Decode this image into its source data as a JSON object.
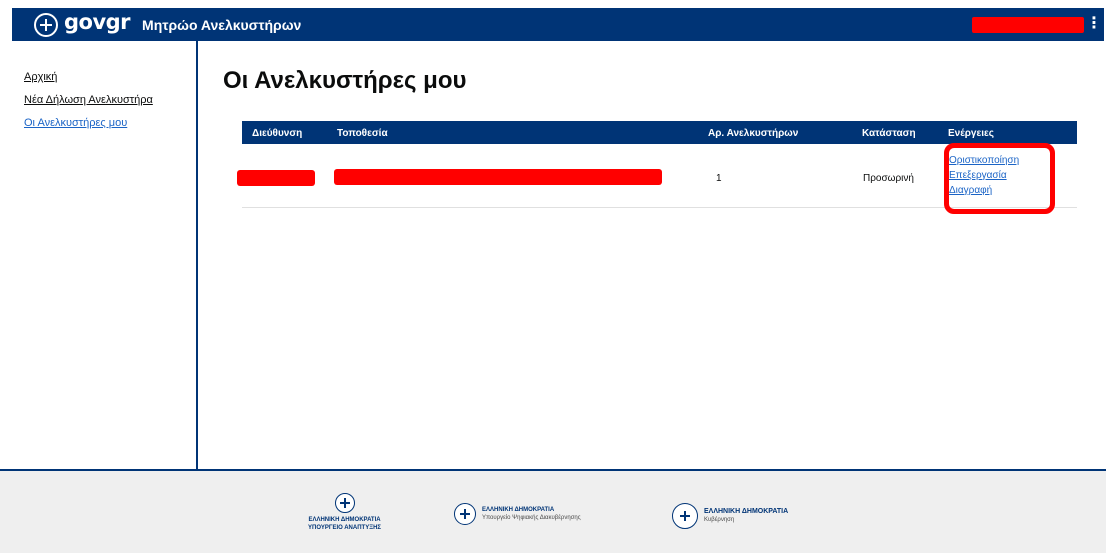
{
  "header": {
    "logo_text": "govgr",
    "app_title": "Μητρώο Ανελκυστήρων",
    "menu_glyph": "⋮",
    "user_redacted": true
  },
  "sidebar": {
    "items": [
      {
        "label": "Αρχική",
        "active": false
      },
      {
        "label": "Νέα Δήλωση Ανελκυστήρα",
        "active": false
      },
      {
        "label": "Οι Ανελκυστήρες μου",
        "active": true
      }
    ]
  },
  "main": {
    "title": "Οι Ανελκυστήρες μου",
    "table": {
      "headers": [
        "Διεύθυνση",
        "Τοποθεσία",
        "Αρ. Ανελκυστήρων",
        "Κατάσταση",
        "Ενέργειες"
      ],
      "rows": [
        {
          "address": "[redacted]",
          "location": "[redacted]",
          "count": "1",
          "status": "Προσωρινή",
          "actions": [
            "Οριστικοποίηση",
            "Επεξεργασία",
            "Διαγραφή"
          ]
        }
      ]
    }
  },
  "footer": {
    "logos": [
      {
        "line1": "ΕΛΛΗΝΙΚΗ ΔΗΜΟΚΡΑΤΙΑ",
        "line2": "ΥΠΟΥΡΓΕΙΟ ΑΝΑΠΤΥΞΗΣ"
      },
      {
        "line1": "ΕΛΛΗΝΙΚΗ ΔΗΜΟΚΡΑΤΙΑ",
        "line2": "Υπουργείο Ψηφιακής Διακυβέρνησης"
      },
      {
        "line1": "ΕΛΛΗΝΙΚΗ ΔΗΜΟΚΡΑΤΙΑ",
        "line2": "Κυβέρνηση"
      }
    ]
  },
  "colors": {
    "header_bg": "#003476",
    "link": "#1b64c6",
    "redaction": "#ff0000",
    "footer_bg": "#efefef"
  }
}
